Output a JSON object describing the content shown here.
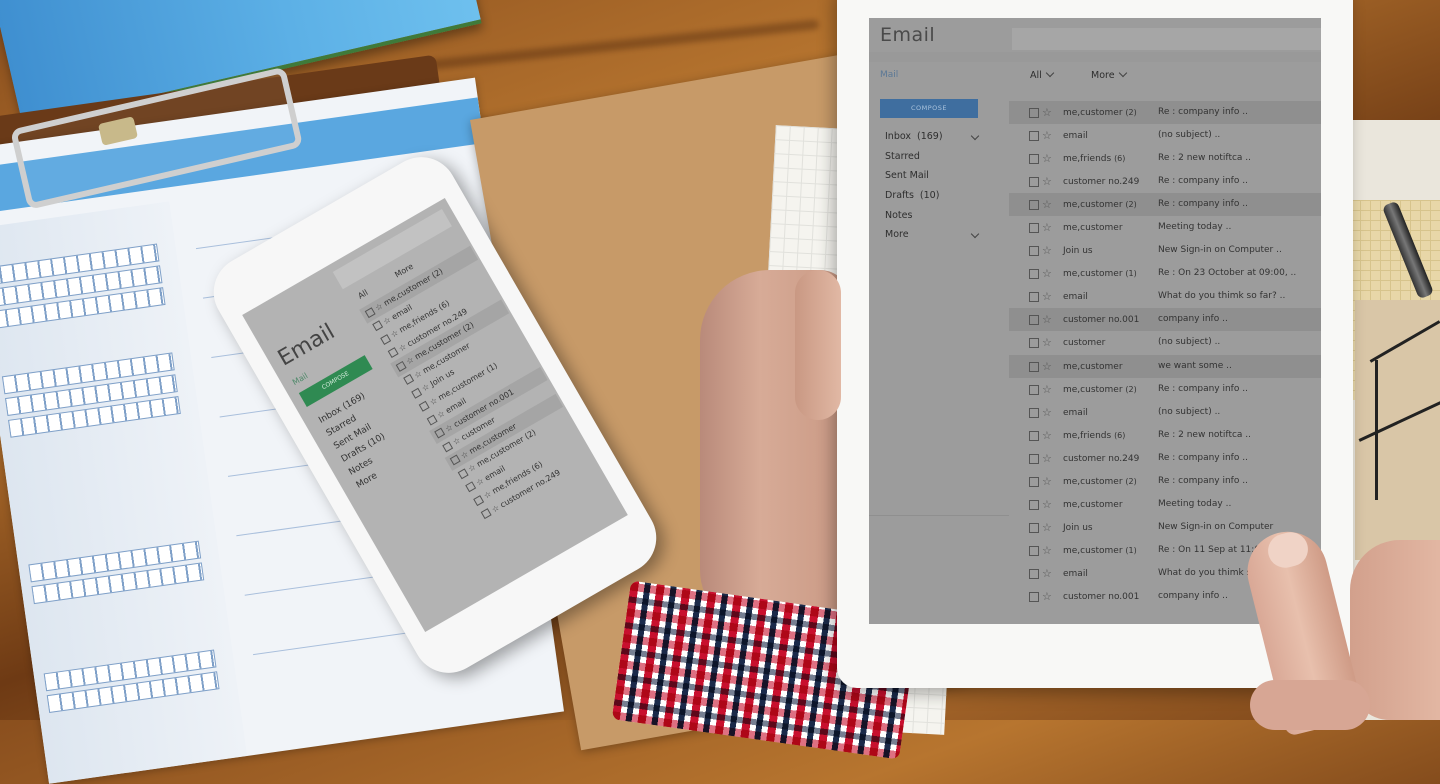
{
  "scene": {
    "description": "Person holding a tablet showing an email inbox, with a smartphone showing the same email app lying on a desk next to clipboard forms",
    "colors": {
      "compose_tablet": "#3f6e9f",
      "compose_phone": "#2f8a52",
      "mail_link": "#5b7896",
      "screen_bg": "#9c9c9c",
      "highlight_row": "#8f8f8f"
    }
  },
  "tablet": {
    "app_title": "Email",
    "nav_mail": "Mail",
    "filters": [
      {
        "label": "All",
        "icon": "chevron-down-icon"
      },
      {
        "label": "More",
        "icon": "chevron-down-icon"
      }
    ],
    "compose_label": "COMPOSE",
    "sidebar": [
      {
        "label": "Inbox",
        "count": "(169)",
        "has_chevron": true
      },
      {
        "label": "Starred",
        "count": "",
        "has_chevron": false
      },
      {
        "label": "Sent Mail",
        "count": "",
        "has_chevron": false
      },
      {
        "label": "Drafts",
        "count": "(10)",
        "has_chevron": false
      },
      {
        "label": "Notes",
        "count": "",
        "has_chevron": false
      },
      {
        "label": "More",
        "count": "",
        "has_chevron": true
      }
    ],
    "emails": [
      {
        "sender": "me,customer",
        "count": "(2)",
        "subject": "Re : company info ..",
        "highlighted": true
      },
      {
        "sender": "email",
        "count": "",
        "subject": "(no subject) ..",
        "highlighted": false
      },
      {
        "sender": "me,friends",
        "count": "(6)",
        "subject": "Re : 2 new notiftca ..",
        "highlighted": false
      },
      {
        "sender": "customer no.249",
        "count": "",
        "subject": "Re : company info ..",
        "highlighted": false
      },
      {
        "sender": "me,customer",
        "count": "(2)",
        "subject": "Re : company info ..",
        "highlighted": true
      },
      {
        "sender": "me,customer",
        "count": "",
        "subject": "Meeting today ..",
        "highlighted": false
      },
      {
        "sender": "Join us",
        "count": "",
        "subject": "New Sign-in on Computer ..",
        "highlighted": false
      },
      {
        "sender": "me,customer",
        "count": "(1)",
        "subject": "Re : On 23 October at 09:00, ..",
        "highlighted": false
      },
      {
        "sender": "email",
        "count": "",
        "subject": "What do you thimk so far? ..",
        "highlighted": false
      },
      {
        "sender": "customer no.001",
        "count": "",
        "subject": "company info ..",
        "highlighted": true
      },
      {
        "sender": "customer",
        "count": "",
        "subject": "(no subject) ..",
        "highlighted": false
      },
      {
        "sender": "me,customer",
        "count": "",
        "subject": "we want some ..",
        "highlighted": true
      },
      {
        "sender": "me,customer",
        "count": "(2)",
        "subject": "Re : company info ..",
        "highlighted": false
      },
      {
        "sender": "email",
        "count": "",
        "subject": "(no subject) ..",
        "highlighted": false
      },
      {
        "sender": "me,friends",
        "count": "(6)",
        "subject": "Re : 2 new notiftca ..",
        "highlighted": false
      },
      {
        "sender": "customer no.249",
        "count": "",
        "subject": "Re : company info ..",
        "highlighted": false
      },
      {
        "sender": "me,customer",
        "count": "(2)",
        "subject": "Re : company info ..",
        "highlighted": false
      },
      {
        "sender": "me,customer",
        "count": "",
        "subject": "Meeting today ..",
        "highlighted": false
      },
      {
        "sender": "Join us",
        "count": "",
        "subject": "New Sign-in on Computer",
        "highlighted": false
      },
      {
        "sender": "me,customer",
        "count": "(1)",
        "subject": "Re : On 11 Sep at 11:00",
        "highlighted": false
      },
      {
        "sender": "email",
        "count": "",
        "subject": "What do you thimk so fa",
        "highlighted": false
      },
      {
        "sender": "customer no.001",
        "count": "",
        "subject": "company info ..",
        "highlighted": false
      }
    ]
  },
  "phone": {
    "app_title": "Email",
    "nav_mail": "Mail",
    "filters": [
      "All",
      "More"
    ],
    "compose_label": "COMPOSE",
    "sidebar": [
      "Inbox (169)",
      "Starred",
      "Sent Mail",
      "Drafts (10)",
      "Notes",
      "More"
    ],
    "emails": [
      {
        "sender": "me,customer (2)",
        "highlighted": true
      },
      {
        "sender": "email",
        "highlighted": false
      },
      {
        "sender": "me,friends (6)",
        "highlighted": false
      },
      {
        "sender": "customer no.249",
        "highlighted": false
      },
      {
        "sender": "me,customer (2)",
        "highlighted": true
      },
      {
        "sender": "me,customer",
        "highlighted": false
      },
      {
        "sender": "Join us",
        "highlighted": false
      },
      {
        "sender": "me,customer (1)",
        "highlighted": false
      },
      {
        "sender": "email",
        "highlighted": false
      },
      {
        "sender": "customer no.001",
        "highlighted": true
      },
      {
        "sender": "customer",
        "highlighted": false
      },
      {
        "sender": "me,customer",
        "highlighted": true
      },
      {
        "sender": "me,customer (2)",
        "highlighted": false
      },
      {
        "sender": "email",
        "highlighted": false
      },
      {
        "sender": "me,friends (6)",
        "highlighted": false
      },
      {
        "sender": "customer no.249",
        "highlighted": false
      }
    ]
  }
}
